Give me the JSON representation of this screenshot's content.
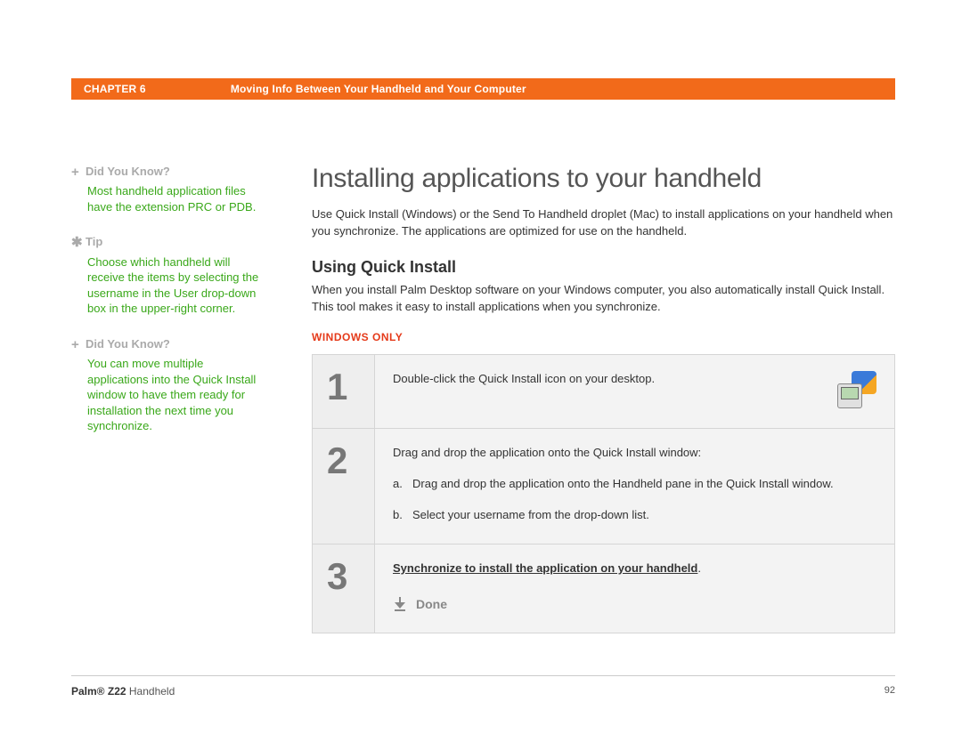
{
  "header": {
    "chapter": "CHAPTER 6",
    "title": "Moving Info Between Your Handheld and Your Computer"
  },
  "sidebar": [
    {
      "icon": "+",
      "title": "Did You Know?",
      "body": "Most handheld application files have the extension PRC or PDB."
    },
    {
      "icon": "✱",
      "title": "Tip",
      "body": "Choose which handheld will receive the items by selecting the username in the User drop-down box in the upper-right corner."
    },
    {
      "icon": "+",
      "title": "Did You Know?",
      "body": "You can move multiple applications into the Quick Install window to have them ready for installation the next time you synchronize."
    }
  ],
  "main": {
    "h1": "Installing applications to your handheld",
    "intro": "Use Quick Install (Windows) or the Send To Handheld droplet (Mac) to install applications on your handheld when you synchronize. The applications are optimized for use on the handheld.",
    "h2": "Using Quick Install",
    "p2": "When you install Palm Desktop software on your Windows computer, you also automatically install Quick Install. This tool makes it easy to install applications when you synchronize.",
    "platform": "WINDOWS ONLY"
  },
  "steps": {
    "s1": {
      "num": "1",
      "text": "Double-click the Quick Install icon on your desktop."
    },
    "s2": {
      "num": "2",
      "lead": "Drag and drop the application onto the Quick Install window:",
      "a_letter": "a.",
      "a": "Drag and drop the application onto the Handheld pane in the Quick Install window.",
      "b_letter": "b.",
      "b": "Select your username from the drop-down list."
    },
    "s3": {
      "num": "3",
      "link": "Synchronize to install the application on your handheld",
      "period": ".",
      "done": "Done"
    }
  },
  "footer": {
    "product_bold": "Palm® Z22",
    "product_rest": " Handheld",
    "page": "92"
  }
}
